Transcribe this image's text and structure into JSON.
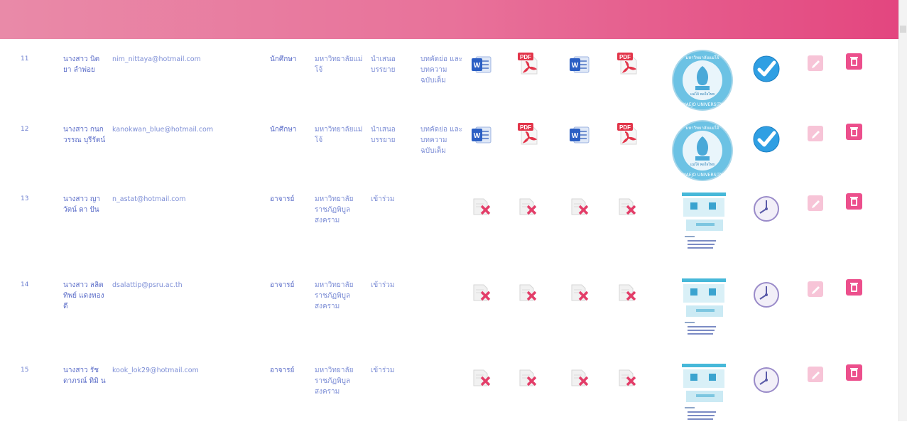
{
  "colors": {
    "header_start": "#e98aa8",
    "header_end": "#e3467f",
    "text": "#6d7fd0",
    "delete": "#ec4f8c",
    "edit": "#f7c4d7",
    "approve": "#2f9fe3"
  },
  "rows": [
    {
      "num": "11",
      "name": "นางสาว นิต ยา ลำพ่อย",
      "email": "nim_nittaya@hotmail.com",
      "position": "นักศึกษา",
      "university": "มหาวิทยาลัยแม่ โจ้",
      "role": "นำเสนอ บรรยาย",
      "type": "บทคัดย่อ และ บทความ ฉบับเต็ม",
      "files": [
        "word-icon",
        "pdf-icon",
        "word-icon",
        "pdf-icon"
      ],
      "proof": "seal",
      "status": "approved"
    },
    {
      "num": "12",
      "name": "นางสาว กนกวรรณ บุรีรัตน์",
      "email": "kanokwan_blue@hotmail.com",
      "position": "นักศึกษา",
      "university": "มหาวิทยาลัยแม่ โจ้",
      "role": "นำเสนอ บรรยาย",
      "type": "บทคัดย่อ และ บทความ ฉบับเต็ม",
      "files": [
        "word-icon",
        "pdf-icon",
        "word-icon",
        "pdf-icon"
      ],
      "proof": "seal",
      "status": "approved"
    },
    {
      "num": "13",
      "name": "นางสาว ญาวัตน์ ดา ปัน",
      "email": "n_astat@hotmail.com",
      "position": "อาจารย์",
      "university": "มหาวิทยาลัย ราชภัฏพิบูล สงคราม",
      "role": "เข้าร่วม",
      "type": "",
      "files": [
        "missing-file-icon",
        "missing-file-icon",
        "missing-file-icon",
        "missing-file-icon"
      ],
      "proof": "receipt",
      "status": "pending"
    },
    {
      "num": "14",
      "name": "นางสาว ลลิตทิพย์ แดงทองดี",
      "email": "dsalattip@psru.ac.th",
      "position": "อาจารย์",
      "university": "มหาวิทยาลัย ราชภัฏพิบูล สงคราม",
      "role": "เข้าร่วม",
      "type": "",
      "files": [
        "missing-file-icon",
        "missing-file-icon",
        "missing-file-icon",
        "missing-file-icon"
      ],
      "proof": "receipt",
      "status": "pending"
    },
    {
      "num": "15",
      "name": "นางสาว รัช ดาภรณ์ ทิมิ น",
      "email": "kook_lok29@hotmail.com",
      "position": "อาจารย์",
      "university": "มหาวิทยาลัย ราชภัฏพิบูล สงคราม",
      "role": "เข้าร่วม",
      "type": "",
      "files": [
        "missing-file-icon",
        "missing-file-icon",
        "missing-file-icon",
        "missing-file-icon"
      ],
      "proof": "receipt",
      "status": "pending"
    }
  ],
  "seal_text": {
    "top": "มหาวิทยาลัยแม่โจ้",
    "bottom": "MAEJO UNIVERSITY",
    "center": "แม่โจ้ พอใจไทย"
  },
  "icons": {
    "word": "word-icon",
    "pdf": "pdf-icon",
    "missing": "missing-file-icon",
    "approved": "check-icon",
    "pending": "clock-icon",
    "edit": "pencil-icon",
    "delete": "trash-icon"
  },
  "pdf_label": "PDF",
  "word_label": "W"
}
